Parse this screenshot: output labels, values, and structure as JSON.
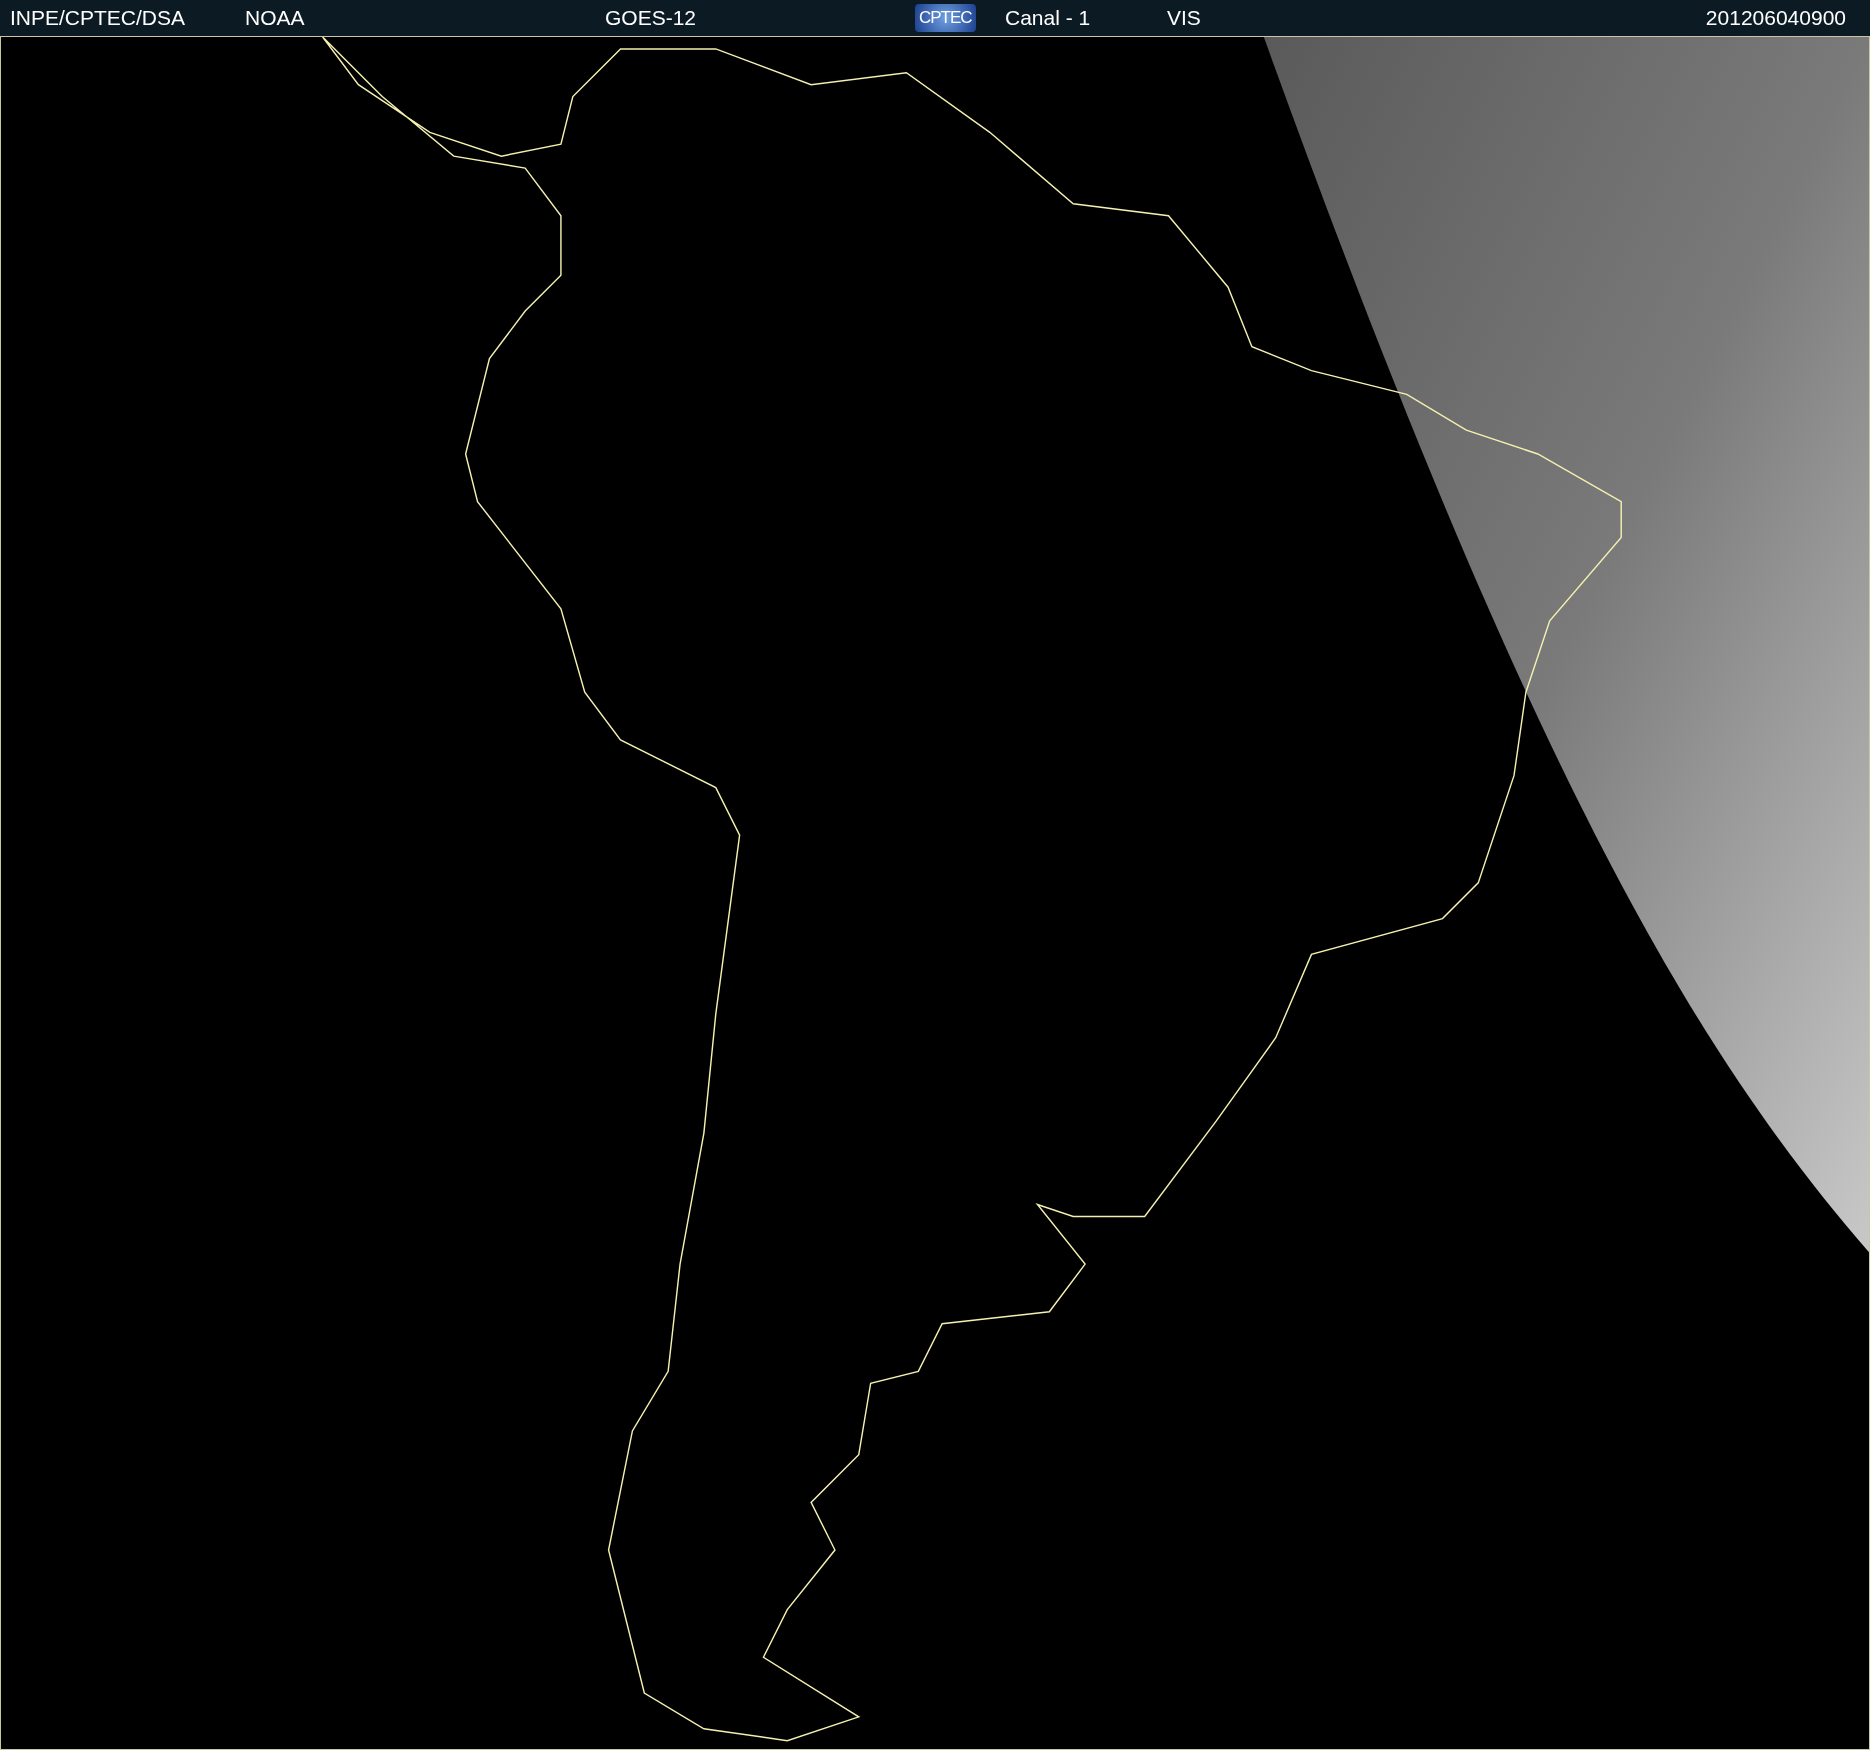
{
  "header": {
    "items": [
      {
        "kind": "text",
        "text": "INPE/CPTEC/DSA"
      },
      {
        "kind": "text",
        "text": "NOAA"
      },
      {
        "kind": "text",
        "text": "GOES-12"
      },
      {
        "kind": "logo",
        "text": "CPTEC"
      },
      {
        "kind": "text",
        "text": "Canal - 1"
      },
      {
        "kind": "text",
        "text": "VIS"
      },
      {
        "kind": "text",
        "text": "201206040900"
      }
    ]
  }
}
